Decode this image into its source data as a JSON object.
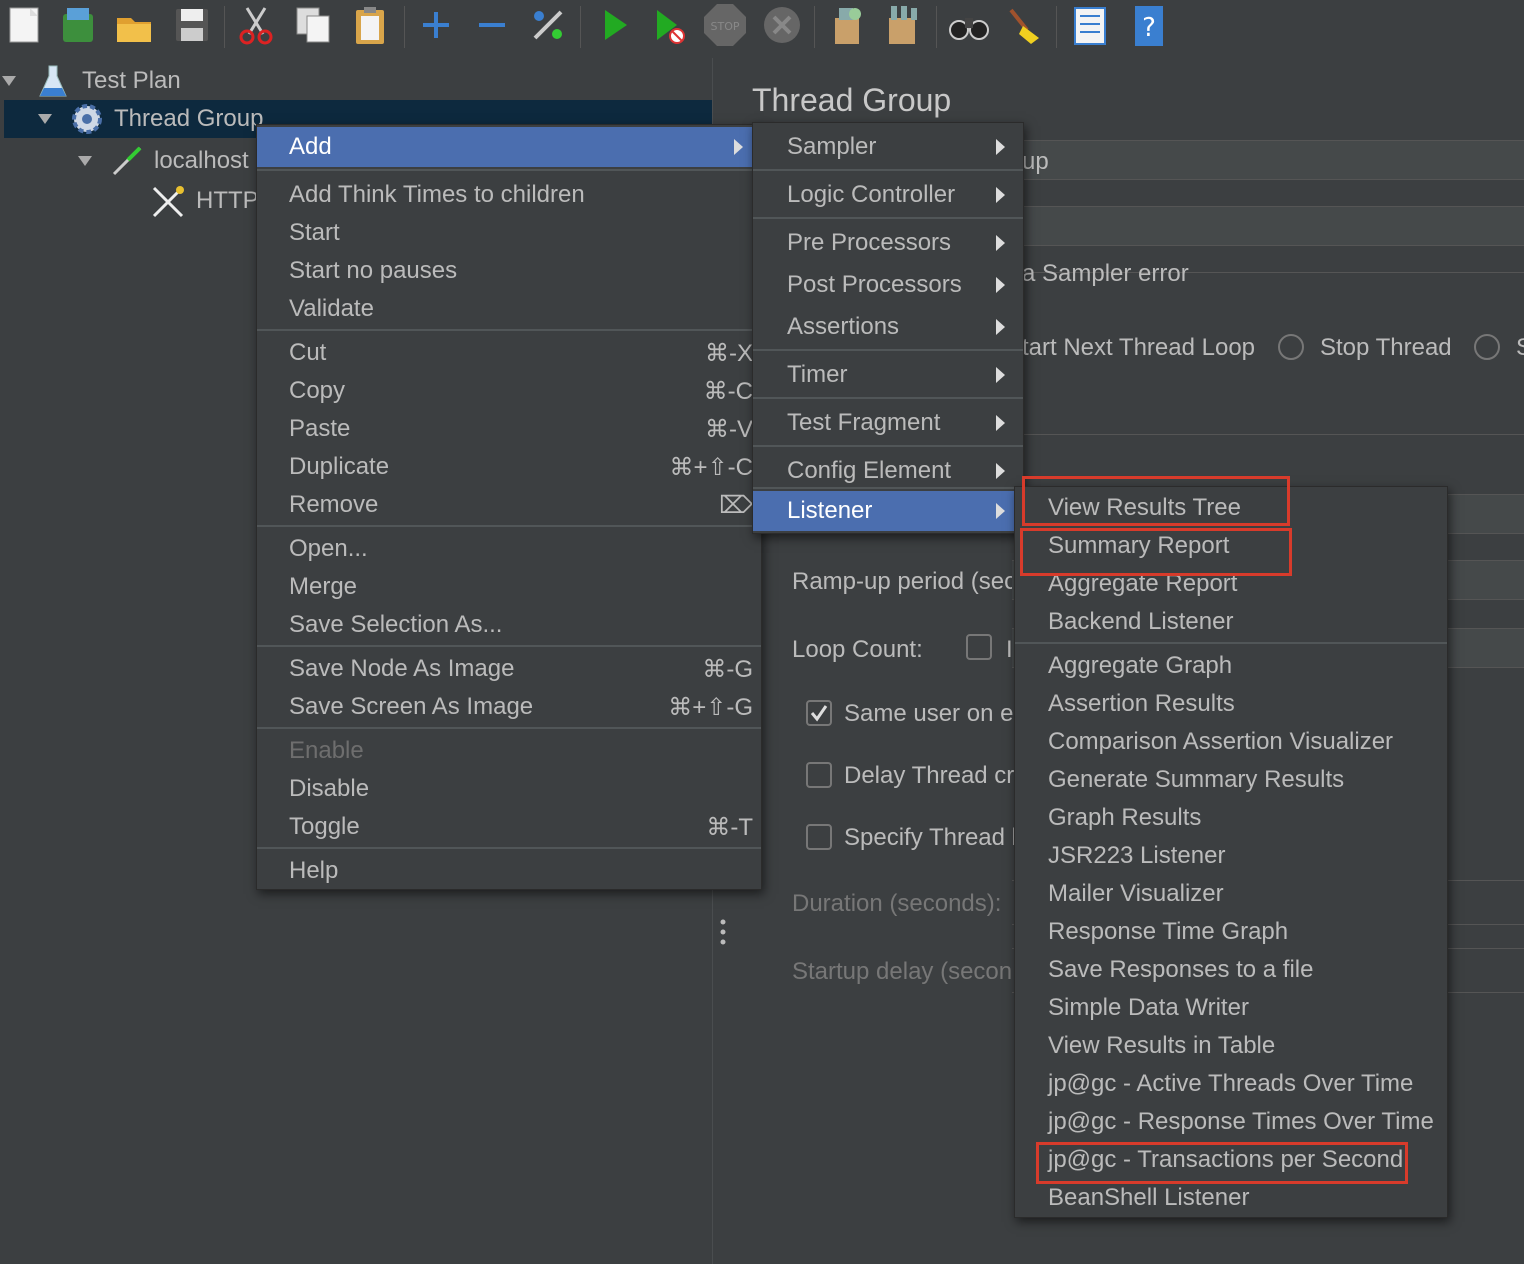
{
  "toolbar": {
    "icons": [
      "new-icon",
      "templates-icon",
      "open-icon",
      "save-icon",
      "cut-icon",
      "copy-icon",
      "paste-icon",
      "expand-icon",
      "collapse-icon",
      "toggle-icon",
      "start-icon",
      "start-no-pauses-icon",
      "stop-icon",
      "shutdown-icon",
      "clear-icon",
      "clear-all-icon",
      "search-icon",
      "reset-search-icon",
      "function-helper-icon",
      "help-icon"
    ],
    "stop_label": "STOP"
  },
  "tree": {
    "test_plan": "Test Plan",
    "thread_group": "Thread Group",
    "localhost": "localhost",
    "http": "HTTP"
  },
  "panel": {
    "title": "Thread Group",
    "name_partial": "up",
    "sampler_error": "a Sampler error",
    "start_next_loop": "tart Next Thread Loop",
    "stop_thread": "Stop Thread",
    "stop_test_partial": "S",
    "rampup": "Ramp-up period (sec",
    "loop_count": "Loop Count:",
    "infinite_partial": "I",
    "same_user": "Same user on ea",
    "delay_thread": "Delay Thread cre",
    "specify_thread": "Specify Thread l",
    "duration": "Duration (seconds):",
    "startup_delay": "Startup delay (secon"
  },
  "context_menu": {
    "items": [
      {
        "label": "Add",
        "shortcut": "",
        "submenu": true,
        "selected": true
      },
      {
        "label": "Add Think Times to children",
        "shortcut": ""
      },
      {
        "label": "Start",
        "shortcut": ""
      },
      {
        "label": "Start no pauses",
        "shortcut": ""
      },
      {
        "label": "Validate",
        "shortcut": ""
      },
      {
        "label": "Cut",
        "shortcut": "⌘-X"
      },
      {
        "label": "Copy",
        "shortcut": "⌘-C"
      },
      {
        "label": "Paste",
        "shortcut": "⌘-V"
      },
      {
        "label": "Duplicate",
        "shortcut": "⌘+⇧-C"
      },
      {
        "label": "Remove",
        "shortcut": "⌦"
      },
      {
        "label": "Open...",
        "shortcut": ""
      },
      {
        "label": "Merge",
        "shortcut": ""
      },
      {
        "label": "Save Selection As...",
        "shortcut": ""
      },
      {
        "label": "Save Node As Image",
        "shortcut": "⌘-G"
      },
      {
        "label": "Save Screen As Image",
        "shortcut": "⌘+⇧-G"
      },
      {
        "label": "Enable",
        "shortcut": "",
        "disabled": true
      },
      {
        "label": "Disable",
        "shortcut": ""
      },
      {
        "label": "Toggle",
        "shortcut": "⌘-T"
      },
      {
        "label": "Help",
        "shortcut": ""
      }
    ]
  },
  "add_submenu": {
    "items": [
      {
        "label": "Sampler"
      },
      {
        "label": "Logic Controller"
      },
      {
        "label": "Pre Processors"
      },
      {
        "label": "Post Processors"
      },
      {
        "label": "Assertions"
      },
      {
        "label": "Timer"
      },
      {
        "label": "Test Fragment"
      },
      {
        "label": "Config Element"
      },
      {
        "label": "Listener",
        "selected": true
      }
    ]
  },
  "listener_submenu": {
    "items": [
      {
        "label": "View Results Tree",
        "highlighted": true
      },
      {
        "label": "Summary Report",
        "highlighted": true
      },
      {
        "label": "Aggregate Report"
      },
      {
        "label": "Backend Listener"
      },
      {
        "label": "Aggregate Graph"
      },
      {
        "label": "Assertion Results"
      },
      {
        "label": "Comparison Assertion Visualizer"
      },
      {
        "label": "Generate Summary Results"
      },
      {
        "label": "Graph Results"
      },
      {
        "label": "JSR223 Listener"
      },
      {
        "label": "Mailer Visualizer"
      },
      {
        "label": "Response Time Graph"
      },
      {
        "label": "Save Responses to a file"
      },
      {
        "label": "Simple Data Writer"
      },
      {
        "label": "View Results in Table"
      },
      {
        "label": "jp@gc - Active Threads Over Time"
      },
      {
        "label": "jp@gc - Response Times Over Time"
      },
      {
        "label": "jp@gc - Transactions per Second",
        "highlighted": true
      },
      {
        "label": "BeanShell Listener"
      }
    ]
  },
  "colors": {
    "selection": "#4b6eaf",
    "highlight_box": "#d83b2b",
    "background": "#3c3f41"
  }
}
